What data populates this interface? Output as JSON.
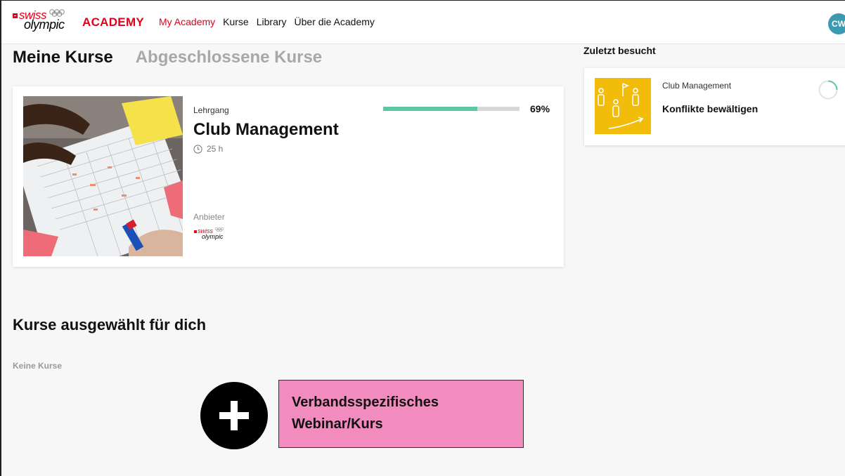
{
  "brand": {
    "swiss": "swiss",
    "olympic": "olympic",
    "academy": "ACADEMY",
    "red": "#e3001b"
  },
  "nav": {
    "items": [
      "My Academy",
      "Kurse",
      "Library",
      "Über die Academy"
    ],
    "active_index": 0
  },
  "user": {
    "initials": "CW",
    "avatar_color": "#3a9bb0"
  },
  "tabs": {
    "active": "Meine Kurse",
    "inactive": "Abgeschlossene Kurse"
  },
  "course": {
    "type": "Lehrgang",
    "title": "Club Management",
    "duration": "25 h",
    "progress_text": "69%",
    "progress_fraction": 0.69,
    "progress_color": "#5cc7a0",
    "provider_label": "Anbieter",
    "provider_logo_swiss": "swiss",
    "provider_logo_olympic": "olympic",
    "thumbnail_icon": "planning-worksheet-photo"
  },
  "recent": {
    "title": "Zuletzt besucht",
    "course": "Club Management",
    "module": "Konflikte bewältigen",
    "thumbnail_icon": "people-flag-growth-icon",
    "thumbnail_color": "#f2bc0a"
  },
  "selected": {
    "title": "Kurse ausgewählt für dich",
    "empty_text": "Keine Kurse"
  },
  "callout": {
    "line1": "Verbandsspezifisches",
    "line2": "Webinar/Kurs",
    "color": "#f28cbf"
  }
}
